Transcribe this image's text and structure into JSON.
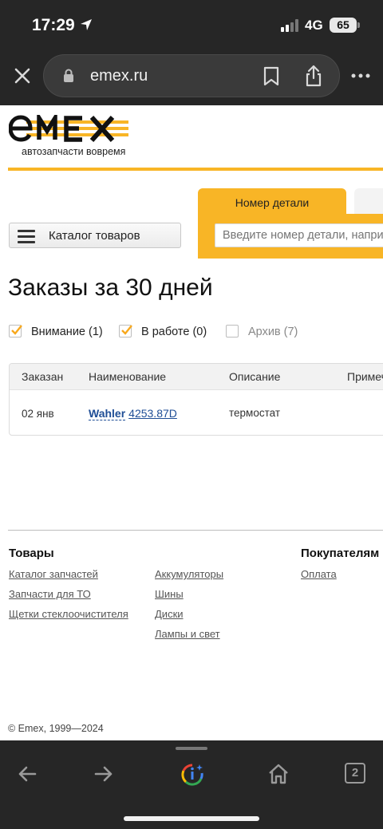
{
  "status_bar": {
    "time": "17:29",
    "network": "4G",
    "battery": "65"
  },
  "browser": {
    "url": "emex.ru",
    "tab_count": "2"
  },
  "site": {
    "logo_text": "emex",
    "tagline": "автозапчасти вовремя",
    "brand_color": "#f8b526"
  },
  "search": {
    "tab_active": "Номер детали",
    "placeholder": "Введите номер детали, например"
  },
  "catalog_button": "Каталог товаров",
  "page_title": "Заказы за 30 дней",
  "filters": [
    {
      "label": "Внимание (1)",
      "checked": true
    },
    {
      "label": "В работе (0)",
      "checked": true
    },
    {
      "label": "Архив (7)",
      "checked": false
    }
  ],
  "orders": {
    "columns": [
      "Заказан",
      "Наименование",
      "Описание",
      "Примеч"
    ],
    "rows": [
      {
        "date": "02 янв",
        "brand": "Wahler",
        "part_number": "4253.87D",
        "description": "термостат"
      }
    ]
  },
  "footer": {
    "goods_heading": "Товары",
    "buyers_heading": "Покупателям",
    "col1": [
      "Каталог запчастей",
      "Запчасти для ТО",
      "Щетки стеклоочистителя"
    ],
    "col2": [
      "Аккумуляторы",
      "Шины",
      "Диски",
      "Лампы и свет"
    ],
    "col3": [
      "Оплата"
    ],
    "copyright": "© Emex, 1999—2024"
  }
}
